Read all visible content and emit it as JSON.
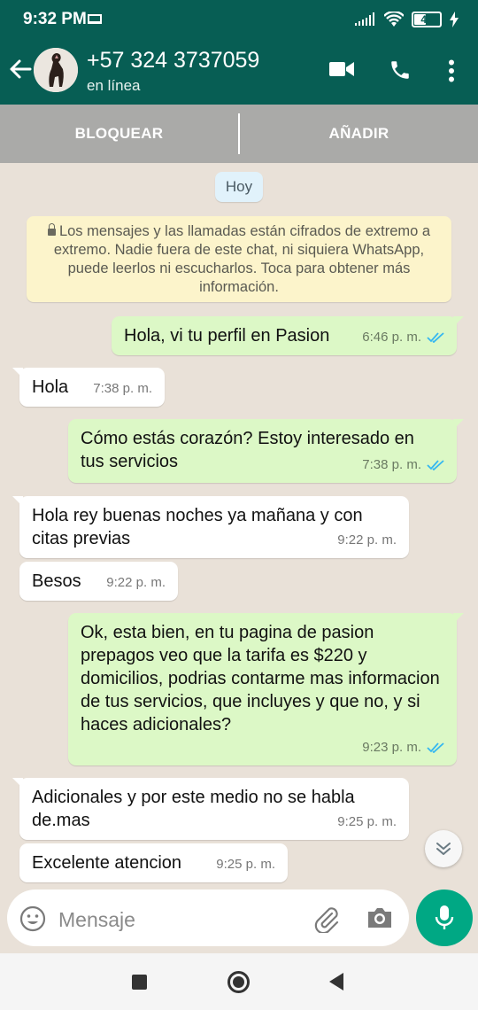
{
  "status_bar": {
    "time": "9:32 PM",
    "battery": "42",
    "battery_level": 0.42
  },
  "header": {
    "contact": "+57 324 3737059",
    "status": "en línea",
    "icons": [
      "back-arrow-icon",
      "video-call-icon",
      "phone-call-icon",
      "more-vert-icon"
    ]
  },
  "actions": {
    "block": "BLOQUEAR",
    "add": "AÑADIR"
  },
  "chat": {
    "date_chip": "Hoy",
    "notice": "Los mensajes y las llamadas están cifrados de extremo a extremo. Nadie fuera de este chat, ni siquiera WhatsApp, puede leerlos ni escucharlos. Toca para obtener más información.",
    "messages": [
      {
        "direction": "out",
        "text": "Hola, vi tu perfil en Pasion",
        "time": "6:46 p. m.",
        "read": true
      },
      {
        "direction": "in",
        "text": "Hola",
        "time": "7:38 p. m."
      },
      {
        "direction": "out",
        "text": "Cómo estás corazón? Estoy interesado en tus servicios",
        "time": "7:38 p. m.",
        "read": true
      },
      {
        "direction": "in",
        "text": "Hola rey  buenas noches ya mañana y con citas previas",
        "time": "9:22 p. m."
      },
      {
        "direction": "in",
        "text": "Besos",
        "time": "9:22 p. m."
      },
      {
        "direction": "out",
        "text": "Ok, esta bien, en tu pagina de pasion prepagos veo que la tarifa es $220 y domicilios, podrias contarme mas informacion de tus servicios, que incluyes y que no, y si haces adicionales?",
        "time": "9:23 p. m.",
        "read": true
      },
      {
        "direction": "in",
        "text": "Adicionales y por este medio no se habla de.mas",
        "time": "9:25 p. m."
      },
      {
        "direction": "in",
        "text": "Excelente atencion",
        "time": "9:25 p. m."
      }
    ]
  },
  "input": {
    "placeholder": "Mensaje"
  },
  "colors": {
    "header": "#075e54",
    "accent": "#00a884",
    "outgoing": "#dcf8c6",
    "read_ticks": "#34b7f1"
  }
}
